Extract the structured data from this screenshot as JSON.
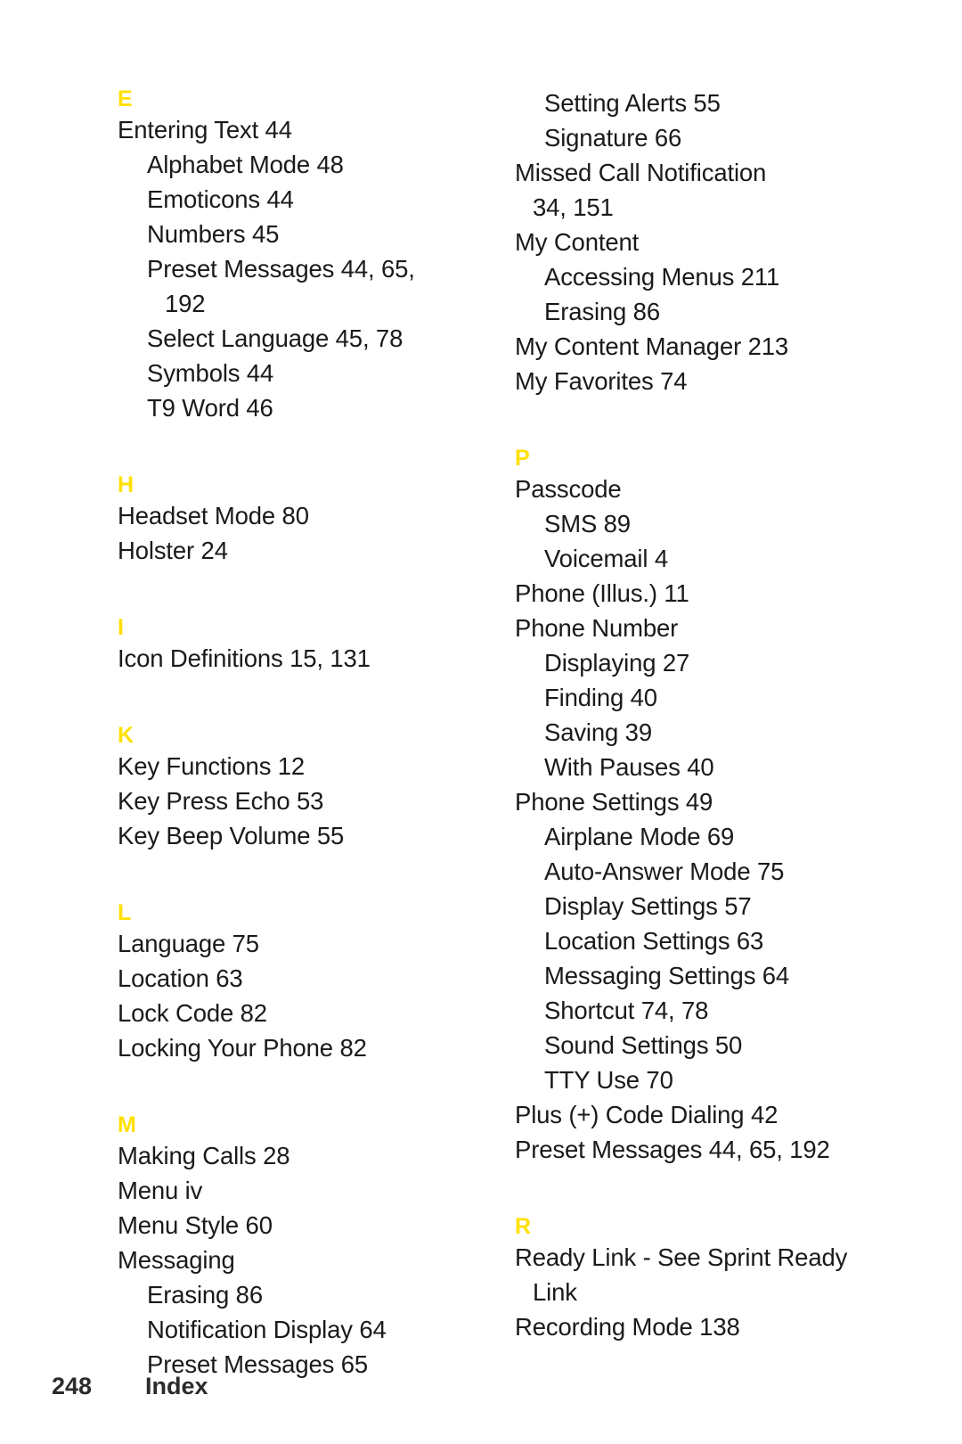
{
  "page": {
    "background_color": "#ffffff",
    "text_color": "#1a1a1a",
    "accent_color": "#FFE000"
  },
  "footer": {
    "page_number": "248",
    "label": "Index"
  },
  "left_column": {
    "sections": [
      {
        "letter": "E",
        "entries": [
          {
            "text": "Entering Text 44",
            "level": 0
          },
          {
            "text": "Alphabet Mode 48",
            "level": 1
          },
          {
            "text": "Emoticons 44",
            "level": 1
          },
          {
            "text": "Numbers 45",
            "level": 1
          },
          {
            "text": "Preset Messages 44, 65,",
            "level": 1
          },
          {
            "text": "192",
            "level": 1,
            "wrap": true
          },
          {
            "text": "Select Language 45, 78",
            "level": 1
          },
          {
            "text": "Symbols 44",
            "level": 1
          },
          {
            "text": "T9 Word 46",
            "level": 1
          }
        ]
      },
      {
        "letter": "H",
        "entries": [
          {
            "text": "Headset Mode 80",
            "level": 0
          },
          {
            "text": "Holster 24",
            "level": 0
          }
        ]
      },
      {
        "letter": "I",
        "entries": [
          {
            "text": "Icon Definitions 15, 131",
            "level": 0
          }
        ]
      },
      {
        "letter": "K",
        "entries": [
          {
            "text": "Key Functions 12",
            "level": 0
          },
          {
            "text": "Key Press Echo 53",
            "level": 0
          },
          {
            "text": "Key Beep Volume 55",
            "level": 0
          }
        ]
      },
      {
        "letter": "L",
        "entries": [
          {
            "text": "Language 75",
            "level": 0
          },
          {
            "text": "Location 63",
            "level": 0
          },
          {
            "text": "Lock Code 82",
            "level": 0
          },
          {
            "text": "Locking Your Phone 82",
            "level": 0
          }
        ]
      },
      {
        "letter": "M",
        "entries": [
          {
            "text": "Making Calls 28",
            "level": 0
          },
          {
            "text": "Menu iv",
            "level": 0
          },
          {
            "text": "Menu Style 60",
            "level": 0
          },
          {
            "text": "Messaging",
            "level": 0
          },
          {
            "text": "Erasing 86",
            "level": 1
          },
          {
            "text": "Notification Display 64",
            "level": 1
          },
          {
            "text": "Preset Messages 65",
            "level": 1
          }
        ]
      }
    ]
  },
  "right_column": {
    "sections": [
      {
        "letter": "",
        "entries": [
          {
            "text": "Setting Alerts 55",
            "level": 1
          },
          {
            "text": "Signature 66",
            "level": 1
          },
          {
            "text": "Missed Call Notification",
            "level": 0
          },
          {
            "text": "34, 151",
            "level": 0,
            "wrap": true
          },
          {
            "text": "My Content",
            "level": 0
          },
          {
            "text": "Accessing Menus 211",
            "level": 1
          },
          {
            "text": "Erasing 86",
            "level": 1
          },
          {
            "text": "My Content Manager 213",
            "level": 0
          },
          {
            "text": "My Favorites 74",
            "level": 0
          }
        ]
      },
      {
        "letter": "P",
        "entries": [
          {
            "text": "Passcode",
            "level": 0
          },
          {
            "text": "SMS  89",
            "level": 1
          },
          {
            "text": "Voicemail 4",
            "level": 1
          },
          {
            "text": "Phone (Illus.) 11",
            "level": 0
          },
          {
            "text": "Phone Number",
            "level": 0
          },
          {
            "text": "Displaying 27",
            "level": 1
          },
          {
            "text": "Finding 40",
            "level": 1
          },
          {
            "text": "Saving 39",
            "level": 1
          },
          {
            "text": "With Pauses 40",
            "level": 1
          },
          {
            "text": "Phone Settings 49",
            "level": 0
          },
          {
            "text": "Airplane Mode 69",
            "level": 1
          },
          {
            "text": "Auto-Answer Mode 75",
            "level": 1
          },
          {
            "text": "Display Settings 57",
            "level": 1
          },
          {
            "text": "Location Settings 63",
            "level": 1
          },
          {
            "text": "Messaging Settings 64",
            "level": 1
          },
          {
            "text": "Shortcut 74, 78",
            "level": 1
          },
          {
            "text": "Sound Settings 50",
            "level": 1
          },
          {
            "text": "TTY Use 70",
            "level": 1
          },
          {
            "text": "Plus (+) Code Dialing 42",
            "level": 0
          },
          {
            "text": "Preset Messages 44, 65, 192",
            "level": 0
          }
        ]
      },
      {
        "letter": "R",
        "entries": [
          {
            "text": "Ready Link - See Sprint Ready",
            "level": 0
          },
          {
            "text": "Link",
            "level": 0,
            "wrap": true
          },
          {
            "text": "Recording Mode 138",
            "level": 0
          }
        ]
      }
    ]
  }
}
